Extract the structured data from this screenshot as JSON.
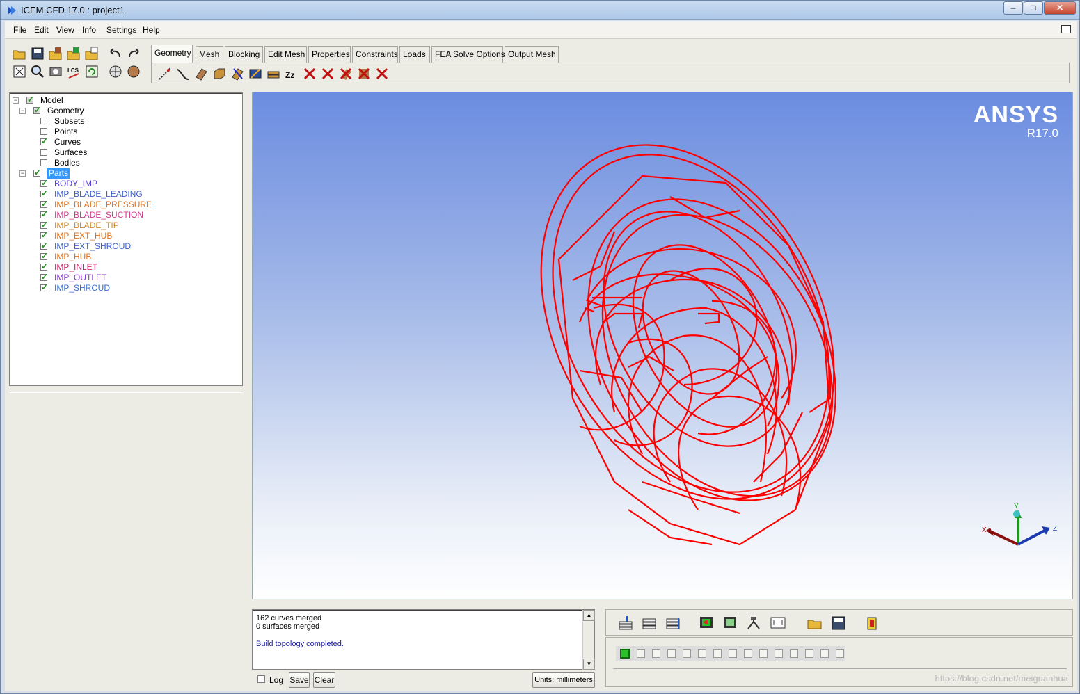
{
  "window": {
    "title": "ICEM CFD 17.0 : project1",
    "minimize": "–",
    "maximize": "□",
    "close": "✕"
  },
  "menubar": {
    "items": [
      "File",
      "Edit",
      "View",
      "Info",
      "Settings",
      "Help"
    ]
  },
  "tabs": [
    "Geometry",
    "Mesh",
    "Blocking",
    "Edit Mesh",
    "Properties",
    "Constraints",
    "Loads",
    "FEA Solve Options",
    "Output Mesh"
  ],
  "active_tab": "Geometry",
  "tree": {
    "model": "Model",
    "geometry": "Geometry",
    "geometry_children": [
      {
        "label": "Subsets",
        "checked": false
      },
      {
        "label": "Points",
        "checked": false
      },
      {
        "label": "Curves",
        "checked": true
      },
      {
        "label": "Surfaces",
        "checked": false
      },
      {
        "label": "Bodies",
        "checked": false
      }
    ],
    "parts": "Parts",
    "part_items": [
      {
        "label": "BODY_IMP",
        "color": "#5a3fd1"
      },
      {
        "label": "IMP_BLADE_LEADING",
        "color": "#3a5fd0"
      },
      {
        "label": "IMP_BLADE_PRESSURE",
        "color": "#e0731e"
      },
      {
        "label": "IMP_BLADE_SUCTION",
        "color": "#d03a8a"
      },
      {
        "label": "IMP_BLADE_TIP",
        "color": "#d08a2a"
      },
      {
        "label": "IMP_EXT_HUB",
        "color": "#e0731e"
      },
      {
        "label": "IMP_EXT_SHROUD",
        "color": "#3a5fd0"
      },
      {
        "label": "IMP_HUB",
        "color": "#e0731e"
      },
      {
        "label": "IMP_INLET",
        "color": "#d0286a"
      },
      {
        "label": "IMP_OUTLET",
        "color": "#8a3ad0"
      },
      {
        "label": "IMP_SHROUD",
        "color": "#3a6fd0"
      }
    ]
  },
  "viewport": {
    "logo": "ANSYS",
    "version": "R17.0",
    "geometry_color": "#ff0000",
    "axes": {
      "x": "X",
      "y": "Y",
      "z": "Z"
    }
  },
  "messages": {
    "line1": "162 curves merged",
    "line2": "0 surfaces merged",
    "line3": "Build topology completed.",
    "log_label": "Log",
    "save_label": "Save",
    "clear_label": "Clear",
    "units": "Units: millimeters"
  },
  "watermark": "https://blog.csdn.net/meiguanhua"
}
